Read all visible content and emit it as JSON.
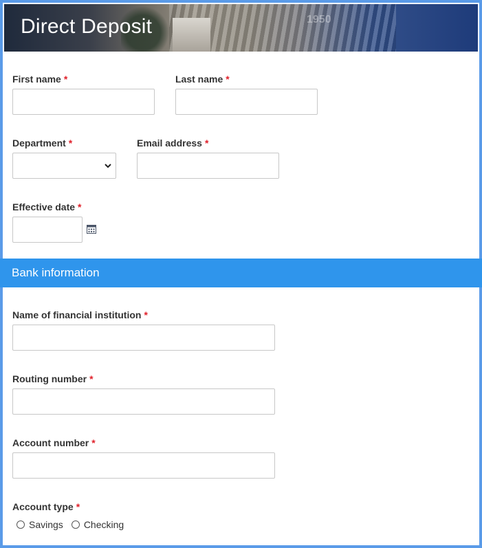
{
  "header": {
    "title": "Direct Deposit",
    "banner_text": "1950"
  },
  "fields": {
    "first_name": {
      "label": "First name",
      "required_mark": "*",
      "value": ""
    },
    "last_name": {
      "label": "Last name",
      "required_mark": "*",
      "value": ""
    },
    "department": {
      "label": "Department",
      "required_mark": "*",
      "selected": ""
    },
    "email": {
      "label": "Email address",
      "required_mark": "*",
      "value": ""
    },
    "effective_date": {
      "label": "Effective date",
      "required_mark": "*",
      "value": ""
    }
  },
  "bank_section": {
    "title": "Bank information"
  },
  "bank_fields": {
    "institution": {
      "label": "Name of financial institution",
      "required_mark": "*",
      "value": ""
    },
    "routing": {
      "label": "Routing number",
      "required_mark": "*",
      "value": ""
    },
    "account": {
      "label": "Account number",
      "required_mark": "*",
      "value": ""
    },
    "account_type": {
      "label": "Account type",
      "required_mark": "*",
      "options": [
        "Savings",
        "Checking"
      ]
    }
  },
  "colors": {
    "border": "#5a9be8",
    "section": "#2f95ec",
    "required": "#e0202a"
  },
  "icons": {
    "calendar": "calendar-icon",
    "dropdown": "chevron-down-icon"
  }
}
